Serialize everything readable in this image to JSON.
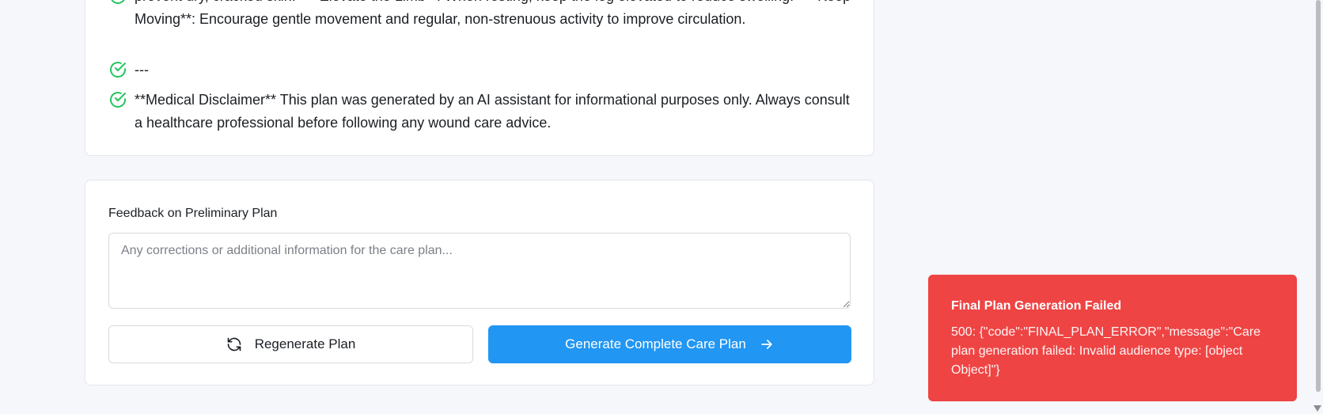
{
  "care_plan": {
    "items": [
      {
        "text": "prevent dry, cracked skin. - **Elevate the Limb**: When resting, keep the leg elevated to reduce swelling. - **Keep Moving**: Encourage gentle movement and regular, non-strenuous activity to improve circulation."
      },
      {
        "text": "---"
      },
      {
        "text": "**Medical Disclaimer** This plan was generated by an AI assistant for informational purposes only. Always consult a healthcare professional before following any wound care advice."
      }
    ],
    "check_color": "#22c55e"
  },
  "feedback": {
    "label": "Feedback on Preliminary Plan",
    "value": "",
    "placeholder": "Any corrections or additional information for the care plan...",
    "regenerate_label": "Regenerate Plan",
    "generate_label": "Generate Complete Care Plan",
    "generate_color": "#2196f3"
  },
  "toast": {
    "title": "Final Plan Generation Failed",
    "message": "500: {\"code\":\"FINAL_PLAN_ERROR\",\"message\":\"Care plan generation failed: Invalid audience type: [object Object]\"}",
    "background": "#ef4444"
  },
  "icons": {
    "check": "check-circle-icon",
    "regenerate": "refresh-icon",
    "generate": "arrow-right-icon"
  }
}
